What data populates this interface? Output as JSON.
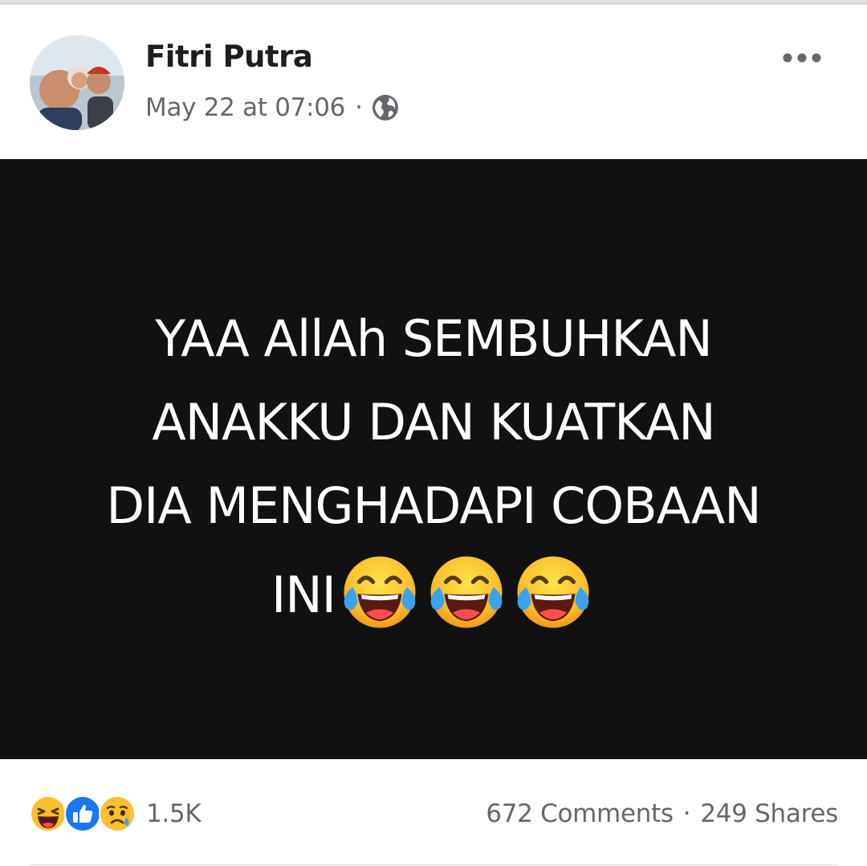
{
  "post": {
    "author": "Fitri Putra",
    "timestamp": "May 22 at 07:06",
    "separator": "·",
    "privacy_icon": "globe-icon",
    "more_icon": "more-horizontal-icon",
    "text_lines": [
      "YAA AllAh SEMBUHKAN",
      "ANAKKU DAN KUATKAN",
      "DIA MENGHADAPI COBAAN",
      "INI"
    ],
    "trailing_emoji": [
      "laughing-tears-emoji",
      "laughing-tears-emoji",
      "laughing-tears-emoji"
    ],
    "background_color": "#111111",
    "text_color": "#ffffff"
  },
  "footer": {
    "reactions": [
      "haha-reaction-icon",
      "like-reaction-icon",
      "sad-reaction-icon"
    ],
    "reaction_count": "1.5K",
    "comments": "672 Comments",
    "separator": "·",
    "shares": "249 Shares"
  },
  "colors": {
    "accent_blue": "#1877f2",
    "secondary_text": "#65676b",
    "primary_text": "#1c1e21"
  }
}
